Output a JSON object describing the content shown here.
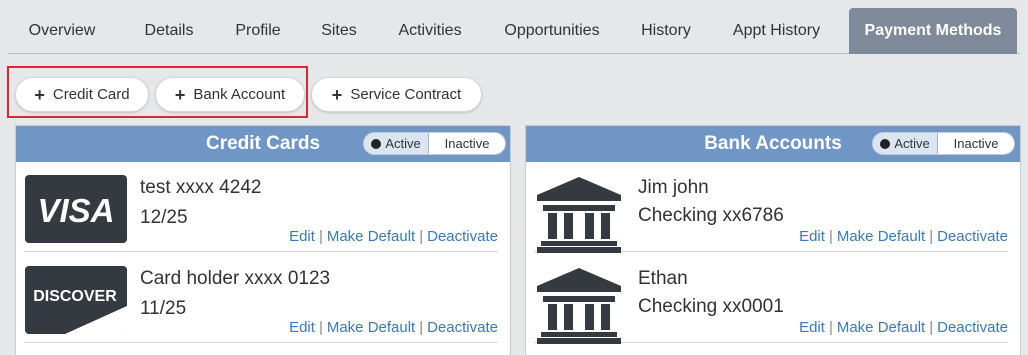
{
  "tabs": [
    {
      "label": "Overview",
      "width": 108
    },
    {
      "label": "Details",
      "width": 106
    },
    {
      "label": "Profile",
      "width": 72
    },
    {
      "label": "Sites",
      "width": 90
    },
    {
      "label": "Activities",
      "width": 92
    },
    {
      "label": "Opportunities",
      "width": 152
    },
    {
      "label": "History",
      "width": 76
    },
    {
      "label": "Appt History",
      "width": 145
    },
    {
      "label": "Payment Methods",
      "width": 168
    }
  ],
  "active_tab": "Payment Methods",
  "actions": {
    "credit_card": "Credit Card",
    "bank_account": "Bank Account",
    "service_contract": "Service Contract"
  },
  "credit_cards": {
    "title": "Credit Cards",
    "toggle_active": "Active",
    "toggle_inactive": "Inactive",
    "items": [
      {
        "brand": "VISA",
        "name": "test xxxx 4242",
        "exp": "12/25",
        "edit": "Edit",
        "make_default": "Make Default",
        "deactivate": "Deactivate"
      },
      {
        "brand": "DISCOVER",
        "name": "Card holder xxxx 0123",
        "exp": "11/25",
        "edit": "Edit",
        "make_default": "Make Default",
        "deactivate": "Deactivate"
      }
    ]
  },
  "bank_accounts": {
    "title": "Bank Accounts",
    "toggle_active": "Active",
    "toggle_inactive": "Inactive",
    "items": [
      {
        "name": "Jim john",
        "account": "Checking xx6786",
        "edit": "Edit",
        "make_default": "Make Default",
        "deactivate": "Deactivate"
      },
      {
        "name": "Ethan",
        "account": "Checking xx0001",
        "edit": "Edit",
        "make_default": "Make Default",
        "deactivate": "Deactivate"
      }
    ]
  },
  "colors": {
    "panel_header": "#6f96c5",
    "active_tab": "#7e8a99",
    "link": "#3a7ab8",
    "highlight": "#e0262d",
    "logo_bg": "#343a40"
  }
}
